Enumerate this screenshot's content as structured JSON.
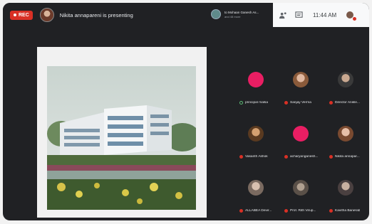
{
  "header": {
    "rec_label": "REC",
    "presenter_text": "Nikita annapareni is presenting",
    "meeting_title": "to Mohaan Ganesh As...",
    "meeting_sub": "and 48 more",
    "clock": "11:44 AM"
  },
  "icons": {
    "record": "record-dot-icon",
    "people": "people-icon",
    "chat": "chat-icon",
    "user": "user-avatar-icon"
  },
  "colors": {
    "rec": "#d93025",
    "background": "#202124",
    "accent_pink": "#e91e63"
  },
  "participants": [
    {
      "name": "principal malsa",
      "avatar": "pink-letter"
    },
    {
      "name": "Sanjay Verma",
      "avatar": "photo"
    },
    {
      "name": "Director Anikle...",
      "avatar": "photo"
    },
    {
      "name": "Vasanth Ashok",
      "avatar": "photo"
    },
    {
      "name": "acharyanganesh...",
      "avatar": "pink-letter"
    },
    {
      "name": "Nikita annapar...",
      "avatar": "photo"
    },
    {
      "name": "ALLABEA Devir...",
      "avatar": "photo"
    },
    {
      "name": "Prof. Rith Virup...",
      "avatar": "photo"
    },
    {
      "name": "Kavitha Banerab",
      "avatar": "photo"
    }
  ]
}
